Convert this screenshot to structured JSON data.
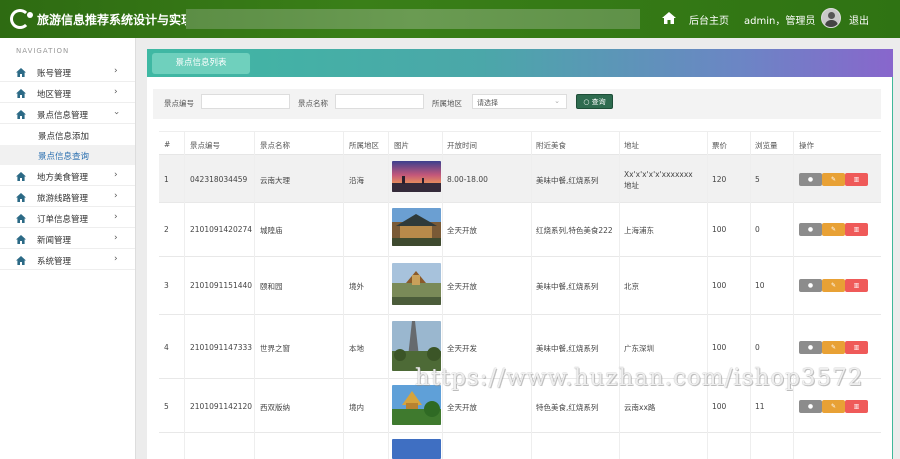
{
  "header": {
    "app_title": "旅游信息推荐系统设计与实现",
    "home_label": "后台主页",
    "user_label": "admin，管理员",
    "logout_label": "退出"
  },
  "sidebar": {
    "caption": "NAVIGATION",
    "items": [
      {
        "label": "账号管理",
        "icon": "home-icon",
        "expandable": true
      },
      {
        "label": "地区管理",
        "icon": "home-icon",
        "expandable": true
      },
      {
        "label": "景点信息管理",
        "icon": "home-icon",
        "expandable": true
      },
      {
        "label": "景点信息添加",
        "sub": true
      },
      {
        "label": "景点信息查询",
        "sub": true,
        "active": true
      },
      {
        "label": "地方美食管理",
        "icon": "home-icon",
        "expandable": true
      },
      {
        "label": "旅游线路管理",
        "icon": "home-icon",
        "expandable": true
      },
      {
        "label": "订单信息管理",
        "icon": "home-icon",
        "expandable": true
      },
      {
        "label": "新闻管理",
        "icon": "home-icon",
        "expandable": true
      },
      {
        "label": "系统管理",
        "icon": "home-icon",
        "expandable": true
      }
    ]
  },
  "panel": {
    "tab_label": "景点信息列表"
  },
  "search": {
    "code_label": "景点编号",
    "code_value": "",
    "name_label": "景点名称",
    "name_value": "",
    "region_label": "所属地区",
    "region_selected": "请选择",
    "button_label": "查询"
  },
  "table": {
    "headers": [
      "#",
      "景点编号",
      "景点名称",
      "所属地区",
      "图片",
      "开放时间",
      "附近美食",
      "地址",
      "票价",
      "浏览量",
      "操作"
    ],
    "rows": [
      {
        "no": "1",
        "code": "042318034459",
        "name": "云南大理",
        "region": "沿海",
        "open": "8.00-18.00",
        "food": "美味中餐,红烧系列",
        "addr": "Xx'x'x'x'x'xxxxxxx 地址",
        "price": "120",
        "views": "5"
      },
      {
        "no": "2",
        "code": "2101091420274",
        "name": "城隍庙",
        "region": "",
        "open": "全天开放",
        "food": "红烧系列,特色美食222",
        "addr": "上海浦东",
        "price": "100",
        "views": "0"
      },
      {
        "no": "3",
        "code": "2101091151440",
        "name": "颐和园",
        "region": "境外",
        "open": "全天开放",
        "food": "美味中餐,红烧系列",
        "addr": "北京",
        "price": "100",
        "views": "10"
      },
      {
        "no": "4",
        "code": "2101091147333",
        "name": "世界之窗",
        "region": "本地",
        "open": "全天开发",
        "food": "美味中餐,红烧系列",
        "addr": "广东深圳",
        "price": "100",
        "views": "0"
      },
      {
        "no": "5",
        "code": "2101091142120",
        "name": "西双版纳",
        "region": "境内",
        "open": "全天开放",
        "food": "特色美食,红烧系列",
        "addr": "云南xx路",
        "price": "100",
        "views": "11"
      }
    ]
  },
  "watermark": "https://www.huzhan.com/ishop3572",
  "colors": {
    "header_green": "#2e6b12",
    "edit_orange": "#e8a135",
    "delete_red": "#ef5a59",
    "view_gray": "#8c8c8c",
    "active_link": "#2a6fb0"
  }
}
